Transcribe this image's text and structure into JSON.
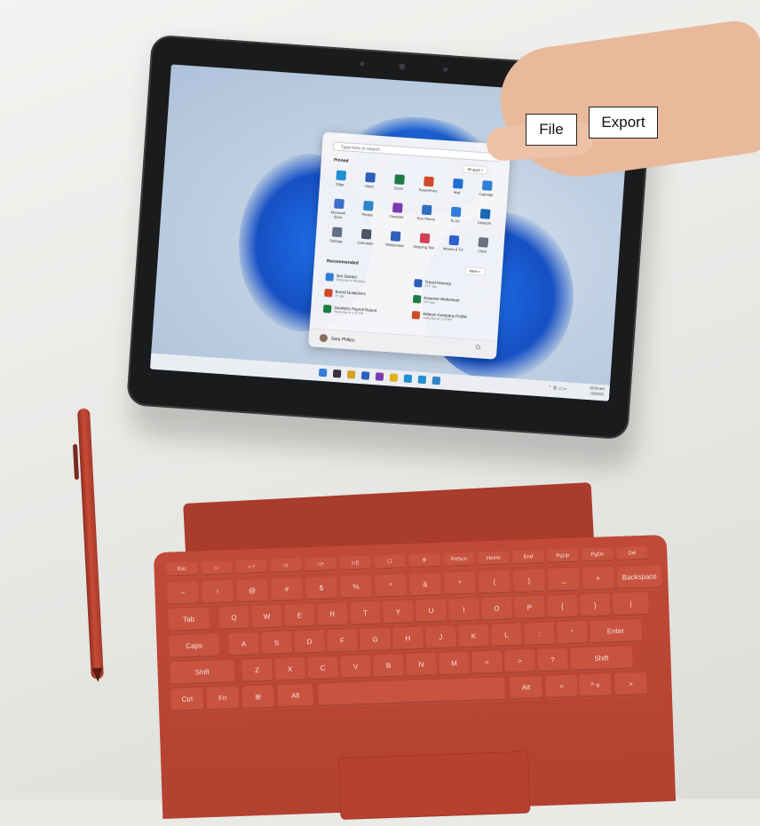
{
  "callouts": {
    "file": "File",
    "export": "Export"
  },
  "start_menu": {
    "search_placeholder": "Type here to search",
    "pinned_title": "Pinned",
    "all_apps": "All apps  >",
    "pinned": [
      {
        "label": "Edge",
        "color": "#1f8fd0"
      },
      {
        "label": "Word",
        "color": "#2b5fb8"
      },
      {
        "label": "Excel",
        "color": "#1e7b45"
      },
      {
        "label": "PowerPoint",
        "color": "#d04a2a"
      },
      {
        "label": "Mail",
        "color": "#1f6fd0"
      },
      {
        "label": "Calendar",
        "color": "#2f7fd6"
      },
      {
        "label": "Microsoft Store",
        "color": "#3a6fd0"
      },
      {
        "label": "Photos",
        "color": "#2f86c8"
      },
      {
        "label": "OneNote",
        "color": "#7b3bb0"
      },
      {
        "label": "Your Phone",
        "color": "#2f6fc0"
      },
      {
        "label": "To Do",
        "color": "#2f7fd8"
      },
      {
        "label": "LinkedIn",
        "color": "#1a66b0"
      },
      {
        "label": "Settings",
        "color": "#667085"
      },
      {
        "label": "Calculator",
        "color": "#4b5563"
      },
      {
        "label": "Whiteboard",
        "color": "#2f5fb8"
      },
      {
        "label": "Snipping Tool",
        "color": "#d43f55"
      },
      {
        "label": "Movies & TV",
        "color": "#2f5fd0"
      },
      {
        "label": "Clock",
        "color": "#6b7280"
      }
    ],
    "recommended_title": "Recommended",
    "more": "More  >",
    "recommended": [
      {
        "name": "Get Started",
        "sub": "Welcome to Windows",
        "color": "#2f7fd8"
      },
      {
        "name": "Travel Itinerary",
        "sub": "17m ago",
        "color": "#2b5fb8"
      },
      {
        "name": "Brand Guidelines",
        "sub": "2h ago",
        "color": "#d04a2a"
      },
      {
        "name": "Expense Worksheet",
        "sub": "12h ago",
        "color": "#1e7b45"
      },
      {
        "name": "Quarterly Payroll Report",
        "sub": "Yesterday at 4:24 PM",
        "color": "#1e7b45"
      },
      {
        "name": "Adatum Company Profile",
        "sub": "Yesterday at 1:15 PM",
        "color": "#d04a2a"
      }
    ],
    "user_name": "Sara Philips"
  },
  "taskbar": {
    "icons": [
      "#2f7fd8",
      "#333333",
      "#d8a020",
      "#2b5fb8",
      "#7b3bb0",
      "#e0b020",
      "#1f8fd0",
      "#1f8fd0",
      "#2f86c8"
    ],
    "time": "10:00 AM",
    "date": "10/20/21"
  },
  "keyboard": {
    "fn_row": [
      "Esc",
      "☼-",
      "☼+",
      "◁-",
      "◁+",
      "▷||",
      "☐",
      "✲",
      "PrtScn",
      "Home",
      "End",
      "PgUp",
      "PgDn",
      "Del"
    ],
    "num_row": [
      "~",
      "!",
      "@",
      "#",
      "$",
      "%",
      "^",
      "&",
      "*",
      "(",
      ")",
      "_",
      "+",
      "Backspace"
    ],
    "top_row": [
      "Tab",
      "Q",
      "W",
      "E",
      "R",
      "T",
      "Y",
      "U",
      "I",
      "O",
      "P",
      "{",
      "}",
      "|"
    ],
    "home_row": [
      "Caps",
      "A",
      "S",
      "D",
      "F",
      "G",
      "H",
      "J",
      "K",
      "L",
      ":",
      "\"",
      "Enter"
    ],
    "shift_row": [
      "Shift",
      "Z",
      "X",
      "C",
      "V",
      "B",
      "N",
      "M",
      "<",
      ">",
      "?",
      "Shift"
    ],
    "bottom_row": [
      "Ctrl",
      "Fn",
      "⊞",
      "Alt",
      "",
      "Alt",
      "<",
      "^ v",
      ">"
    ]
  }
}
